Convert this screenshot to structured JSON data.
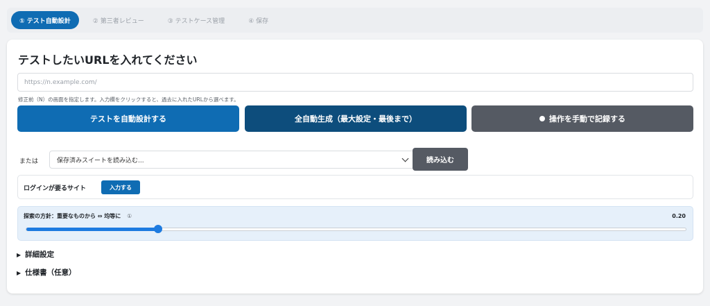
{
  "stepper": {
    "steps": [
      {
        "label": "① テスト自動設計",
        "active": true
      },
      {
        "label": "② 第三者レビュー",
        "active": false
      },
      {
        "label": "③ テストケース管理",
        "active": false
      },
      {
        "label": "④ 保存",
        "active": false
      }
    ]
  },
  "main": {
    "title": "テストしたいURLを入れてください",
    "url_placeholder": "https://n.example.com/",
    "url_hint": "修正前（N）の画面を指定します。入力欄をクリックすると、過去に入れたURLから選べます。",
    "buttons": {
      "auto_design": "テストを自動設計する",
      "full_auto": "全自動生成（最大設定・最後まで）",
      "manual_record": "操作を手動で記録する"
    },
    "suite": {
      "or_label": "または",
      "select_value": "保存済みスイートを読み込む...",
      "load_button": "読み込む"
    },
    "login": {
      "label": "ログインが要るサイト",
      "enter_button": "入力する"
    },
    "policy": {
      "label": "探索の方針：重要なものから ⇔ 均等に",
      "info_icon": "①",
      "value_text": "0.20",
      "value": 0.2
    },
    "sections": {
      "advanced": "詳細設定",
      "spec": "仕様書（任意）"
    }
  },
  "colors": {
    "primary": "#0f6cb3",
    "primary_dark": "#0d4d7c",
    "neutral": "#555a63",
    "slider": "#1e7be0"
  }
}
